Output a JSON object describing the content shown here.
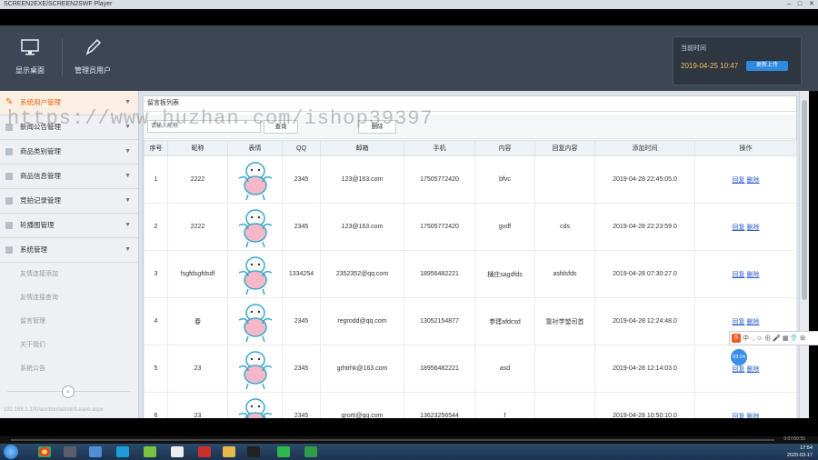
{
  "window": {
    "title": "SCREEN2EXE/SCREEN2SWF Player",
    "controls": [
      "–",
      "□",
      "✕"
    ]
  },
  "header": {
    "buttons": [
      {
        "label": "显示桌面",
        "icon": "monitor-icon"
      },
      {
        "label": "管理员用户",
        "icon": "pencil-icon"
      }
    ],
    "time_label": "当前时间",
    "time_value": "2019-04-25 10:47",
    "time_tag": "更新上传"
  },
  "sidebar": {
    "items": [
      {
        "label": "系统用户管理",
        "active": true
      },
      {
        "label": "新闻公告管理"
      },
      {
        "label": "商品类别管理"
      },
      {
        "label": "商品信息管理"
      },
      {
        "label": "竞拍记录管理"
      },
      {
        "label": "轮播图管理"
      },
      {
        "label": "系统管理"
      }
    ],
    "subitems": [
      "友情连接添加",
      "友情连接查询",
      "留言管理",
      "关于我们",
      "系统公告"
    ],
    "collapse_label": "‹",
    "footer": "192.168.1.100/auction/admin/Leave.aspx"
  },
  "watermark": "https://www.huzhan.com/ishop39397",
  "panel": {
    "title": "留言板列表",
    "search_placeholder": "请输入昵称",
    "search_button": "查询",
    "search_button2": "删除"
  },
  "table": {
    "headers": [
      "序号",
      "昵称",
      "表情",
      "QQ",
      "邮箱",
      "手机",
      "内容",
      "回复内容",
      "添加时间",
      "操作"
    ],
    "rows": [
      {
        "id": "1",
        "nick": "2222",
        "qq": "2345",
        "email": "123@163.com",
        "phone": "17505772420",
        "content": "bfvc",
        "reply": "",
        "time": "2019-04-28 22:45:05.0",
        "op1": "回复",
        "op2": "删除"
      },
      {
        "id": "2",
        "nick": "2222",
        "qq": "2345",
        "email": "123@163.com",
        "phone": "17505772420",
        "content": "gvdf",
        "reply": "cds",
        "time": "2019-04-28 22:23:59.0",
        "op1": "回复",
        "op2": "删除"
      },
      {
        "id": "3",
        "nick": "fsgfdsgfdsdf",
        "qq": "1334254",
        "email": "2352352@qq.com",
        "phone": "18956482221",
        "content": "樋庄sagdfds",
        "reply": "asfdsfds",
        "time": "2019-04-28 07:30:27.0",
        "op1": "回复",
        "op2": "删除"
      },
      {
        "id": "4",
        "nick": "春",
        "qq": "2345",
        "email": "regrodd@qq.com",
        "phone": "13052154877",
        "content": "参建afdcsd",
        "reply": "靠衬学堃司首",
        "time": "2019-04-28 12:24:48.0",
        "op1": "回复",
        "op2": "删除"
      },
      {
        "id": "5",
        "nick": "23",
        "qq": "2345",
        "email": "grhtrhk@163.com",
        "phone": "18956482221",
        "content": "asd",
        "reply": "",
        "time": "2019-04-28 12:14:03.0",
        "op1": "回复",
        "op2": "删除"
      },
      {
        "id": "6",
        "nick": "23",
        "qq": "2345",
        "email": "grorti@qq.com",
        "phone": "13623256544",
        "content": "f",
        "reply": "",
        "time": "2019-04-28 10:50:10.0",
        "op1": "回复",
        "op2": "删除"
      }
    ]
  },
  "ime": {
    "logo": "S",
    "text": "中 ·, ☺ ⊕ 🎤 ▦ 👕 ⊞"
  },
  "bubble": "03:24",
  "taskbar": {
    "time": "17:54",
    "date": "2020-03-17"
  },
  "player": {
    "time": "0:07/00:55"
  }
}
